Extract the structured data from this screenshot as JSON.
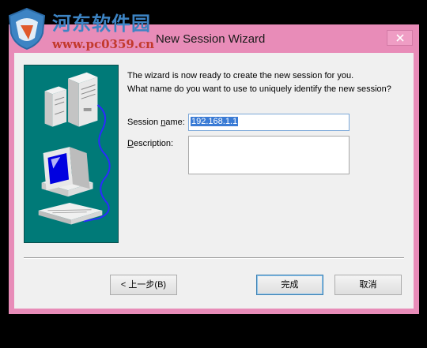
{
  "watermark": {
    "site_name": "河东软件园",
    "url": "www.pc0359.cn",
    "logo_icon": "shield-logo-icon"
  },
  "window": {
    "title": "New Session Wizard",
    "close_icon": "close-icon",
    "frame_color": "#e88cb8"
  },
  "wizard": {
    "intro_line1": "The wizard is now ready to create the new session for you.",
    "intro_line2": "What name do you want to use to uniquely identify the new session?",
    "illustration_icon": "computer-network-illustration"
  },
  "form": {
    "session_label_pre": "Session ",
    "session_label_key": "n",
    "session_label_post": "ame:",
    "session_value": "192.168.1.1",
    "description_label_key": "D",
    "description_label_post": "escription:",
    "description_value": ""
  },
  "buttons": {
    "back": "< 上一步(B)",
    "finish": "完成",
    "cancel": "取消"
  }
}
